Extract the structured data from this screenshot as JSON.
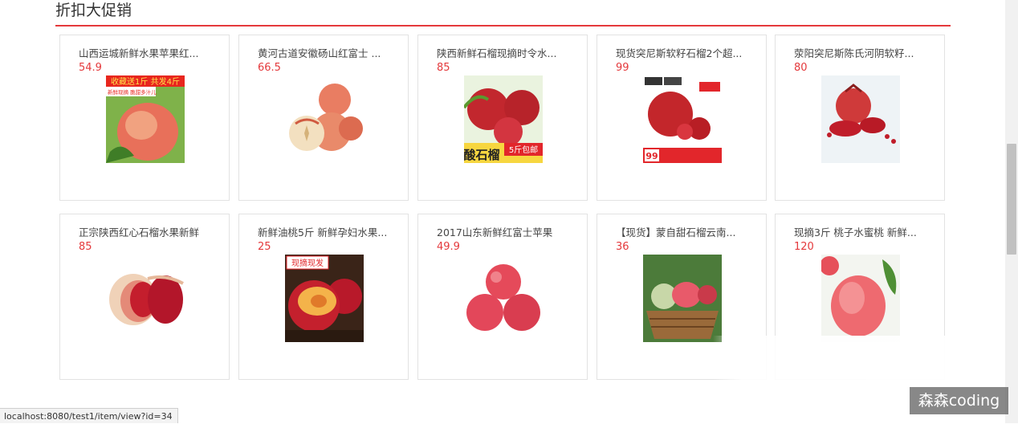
{
  "section": {
    "title": "折扣大促销"
  },
  "products": [
    {
      "name": "山西运城新鲜水果苹果红...",
      "price": "54.9",
      "image": "red-apples-promo-photo",
      "image_text": [
        "收藏送1斤 共发4斤",
        "新鲜现摘 脆甜多汁儿"
      ]
    },
    {
      "name": "黄河古道安徽砀山红富士 ...",
      "price": "66.5",
      "image": "fuji-apples-photo"
    },
    {
      "name": "陕西新鲜石榴现摘时令水...",
      "price": "85",
      "image": "pomegranates-promo-photo",
      "image_text": [
        "酸石榴",
        "5斤包邮"
      ]
    },
    {
      "name": "现货突尼斯软籽石榴2个超...",
      "price": "99",
      "image": "tunisian-pomegranate-photo",
      "image_text": [
        "99"
      ]
    },
    {
      "name": "荥阳突尼斯陈氏河阴软籽...",
      "price": "80",
      "image": "pomegranate-seeds-photo"
    },
    {
      "name": "正宗陕西红心石榴水果新鲜",
      "price": "85",
      "image": "red-pomegranate-photo"
    },
    {
      "name": "新鲜油桃5斤 新鲜孕妇水果...",
      "price": "25",
      "image": "nectarines-photo",
      "image_text": [
        "现摘现发"
      ]
    },
    {
      "name": "2017山东新鲜红富士苹果",
      "price": "49.9",
      "image": "red-apples-photo"
    },
    {
      "name": "【现货】蒙自甜石榴云南...",
      "price": "36",
      "image": "pomegranate-basket-photo"
    },
    {
      "name": "现摘3斤 桃子水蜜桃 新鲜...",
      "price": "120",
      "image": "peach-photo"
    }
  ],
  "status_bar": {
    "url": "localhost:8080/test1/item/view?id=34"
  },
  "watermark": {
    "text": "森森coding"
  },
  "colors": {
    "accent": "#e4393c",
    "border": "#e2e2e2",
    "text": "#444444"
  }
}
